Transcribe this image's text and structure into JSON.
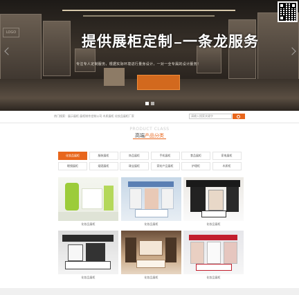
{
  "banner": {
    "title_a": "提供",
    "title_b": "展柜定制",
    "title_c": "一条龙服务",
    "subtitle": "专注专人定制服务，根据实际环境进行量身设计，一对一全专属的设计服务！",
    "logo_text": "LOGO",
    "slides": 2,
    "active_slide": 1
  },
  "hot": {
    "text": "热门搜索：展示展柜 展柜制作定制公司 木质展柜 化妆品展柜厂家",
    "search_placeholder": "请输入搜索关键字"
  },
  "section": {
    "en": "PRODUCT CLASS",
    "cn_a": "高端",
    "cn_b": "产品分类"
  },
  "categories": [
    "化妆品展柜",
    "服装展柜",
    "饰品展柜",
    "手机展柜",
    "食品展柜",
    "家电展柜",
    "眼镜展柜",
    "烟酒展柜",
    "珠宝展柜",
    "家纺产品展柜",
    "护理柜",
    "木质柜"
  ],
  "products": [
    {
      "caption": "化妆品展柜"
    },
    {
      "caption": "化妆品展柜"
    },
    {
      "caption": "化妆品展柜"
    },
    {
      "caption": "化妆品展柜"
    },
    {
      "caption": "化妆品展柜"
    },
    {
      "caption": "化妆品展柜"
    }
  ],
  "colors": {
    "accent": "#e8661c"
  }
}
